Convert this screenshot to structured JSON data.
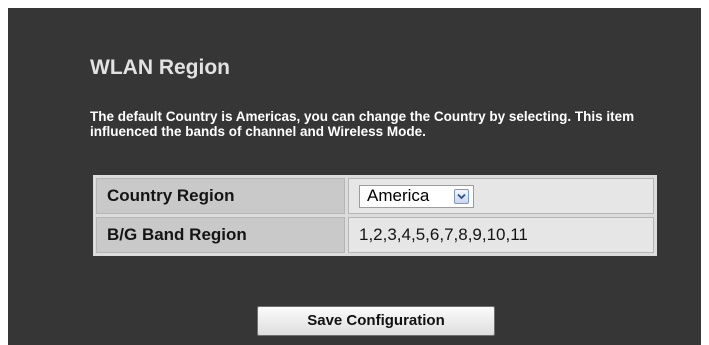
{
  "page": {
    "title": "WLAN Region",
    "description": "The default Country is Americas, you can change the Country by selecting. This item influenced the bands of channel and Wireless Mode."
  },
  "settings": {
    "country_region": {
      "label": "Country Region",
      "selected": "America"
    },
    "bg_band_region": {
      "label": "B/G Band Region",
      "value": "1,2,3,4,5,6,7,8,9,10,11"
    }
  },
  "actions": {
    "save_label": "Save Configuration"
  },
  "colors": {
    "panel_background": "#363636",
    "label_cell": "#c9c9c9",
    "value_cell": "#e6e6e6",
    "dropdown_button": "#c7d7ef"
  },
  "icons": {
    "dropdown": "chevron-down-icon"
  }
}
